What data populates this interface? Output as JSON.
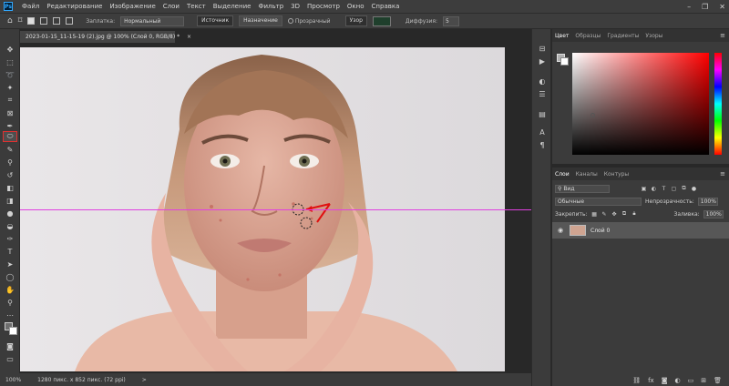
{
  "app": {
    "logo_text": "Ps"
  },
  "menu": [
    "Файл",
    "Редактирование",
    "Изображение",
    "Слои",
    "Текст",
    "Выделение",
    "Фильтр",
    "3D",
    "Просмотр",
    "Окно",
    "Справка"
  ],
  "options": {
    "fill_label": "Заплатка:",
    "mode_value": "Нормальный",
    "source_label": "Источник",
    "dest_label": "Назначение",
    "transparent_label": "Прозрачный",
    "pattern_label": "Узор",
    "diffusion_label": "Диффузия:",
    "diffusion_value": "5"
  },
  "document": {
    "tab_title": "2023-01-15_11-15-19 (2).jpg @ 100% (Слой 0, RGB/8) *",
    "close_glyph": "×"
  },
  "status": {
    "zoom": "100%",
    "info": "1280 пикс. x 852 пикс. (72 ppi)",
    "arrow": ">"
  },
  "color_panel": {
    "tabs": [
      "Цвет",
      "Образцы",
      "Градиенты",
      "Узоры"
    ],
    "active_tab": "Цвет",
    "hue_color": "#ff0000"
  },
  "layers_panel": {
    "tabs": [
      "Слои",
      "Каналы",
      "Контуры"
    ],
    "active_tab": "Слои",
    "filter_value": "Вид",
    "blend_value": "Обычные",
    "opacity_label": "Непрозрачность:",
    "opacity_value": "100%",
    "lock_label": "Закрепить:",
    "fill_label": "Заливка:",
    "fill_value": "100%",
    "layer_name": "Слой 0"
  },
  "colors": {
    "guide": "#e040e0",
    "active_tool_outline": "#e03030",
    "annotation_arrow": "#e01010"
  }
}
